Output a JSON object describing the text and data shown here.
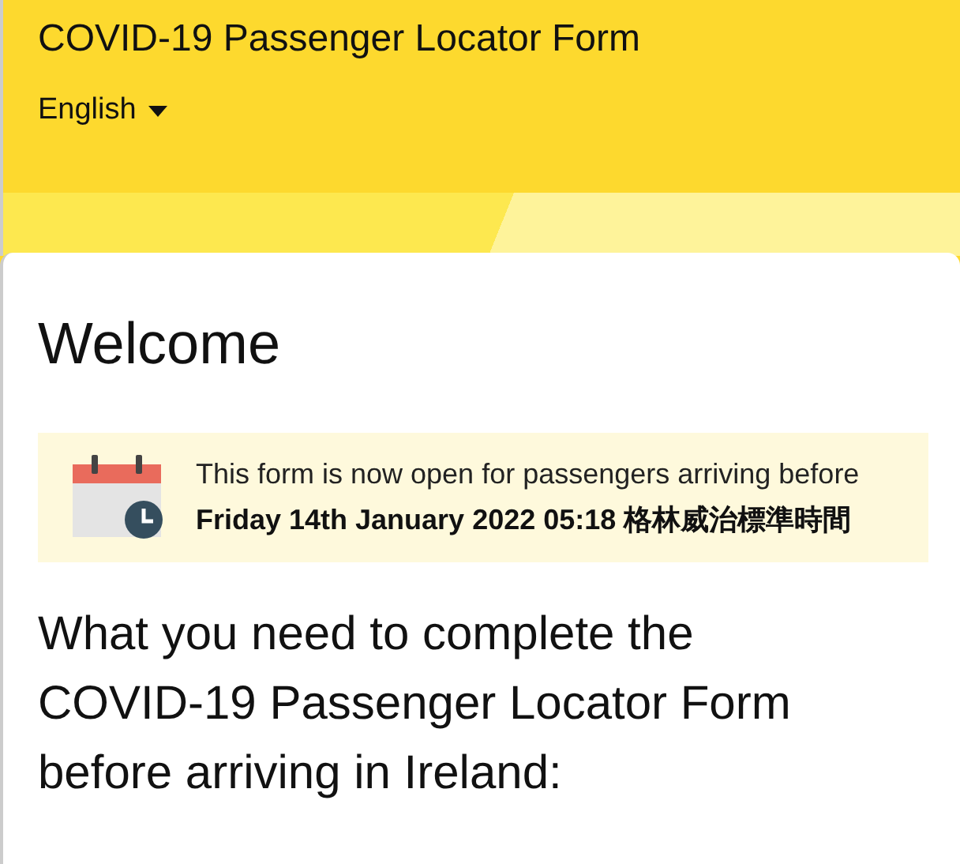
{
  "header": {
    "title": "COVID-19 Passenger Locator Form",
    "language": "English"
  },
  "welcome": {
    "heading": "Welcome"
  },
  "notice": {
    "text": "This form is now open for passengers arriving before **Friday 14th January 2022 05:18 格林威治標準時間**"
  },
  "section": {
    "heading": "What you need to complete the COVID-19 Passenger Locator Form before arriving in Ireland:"
  }
}
